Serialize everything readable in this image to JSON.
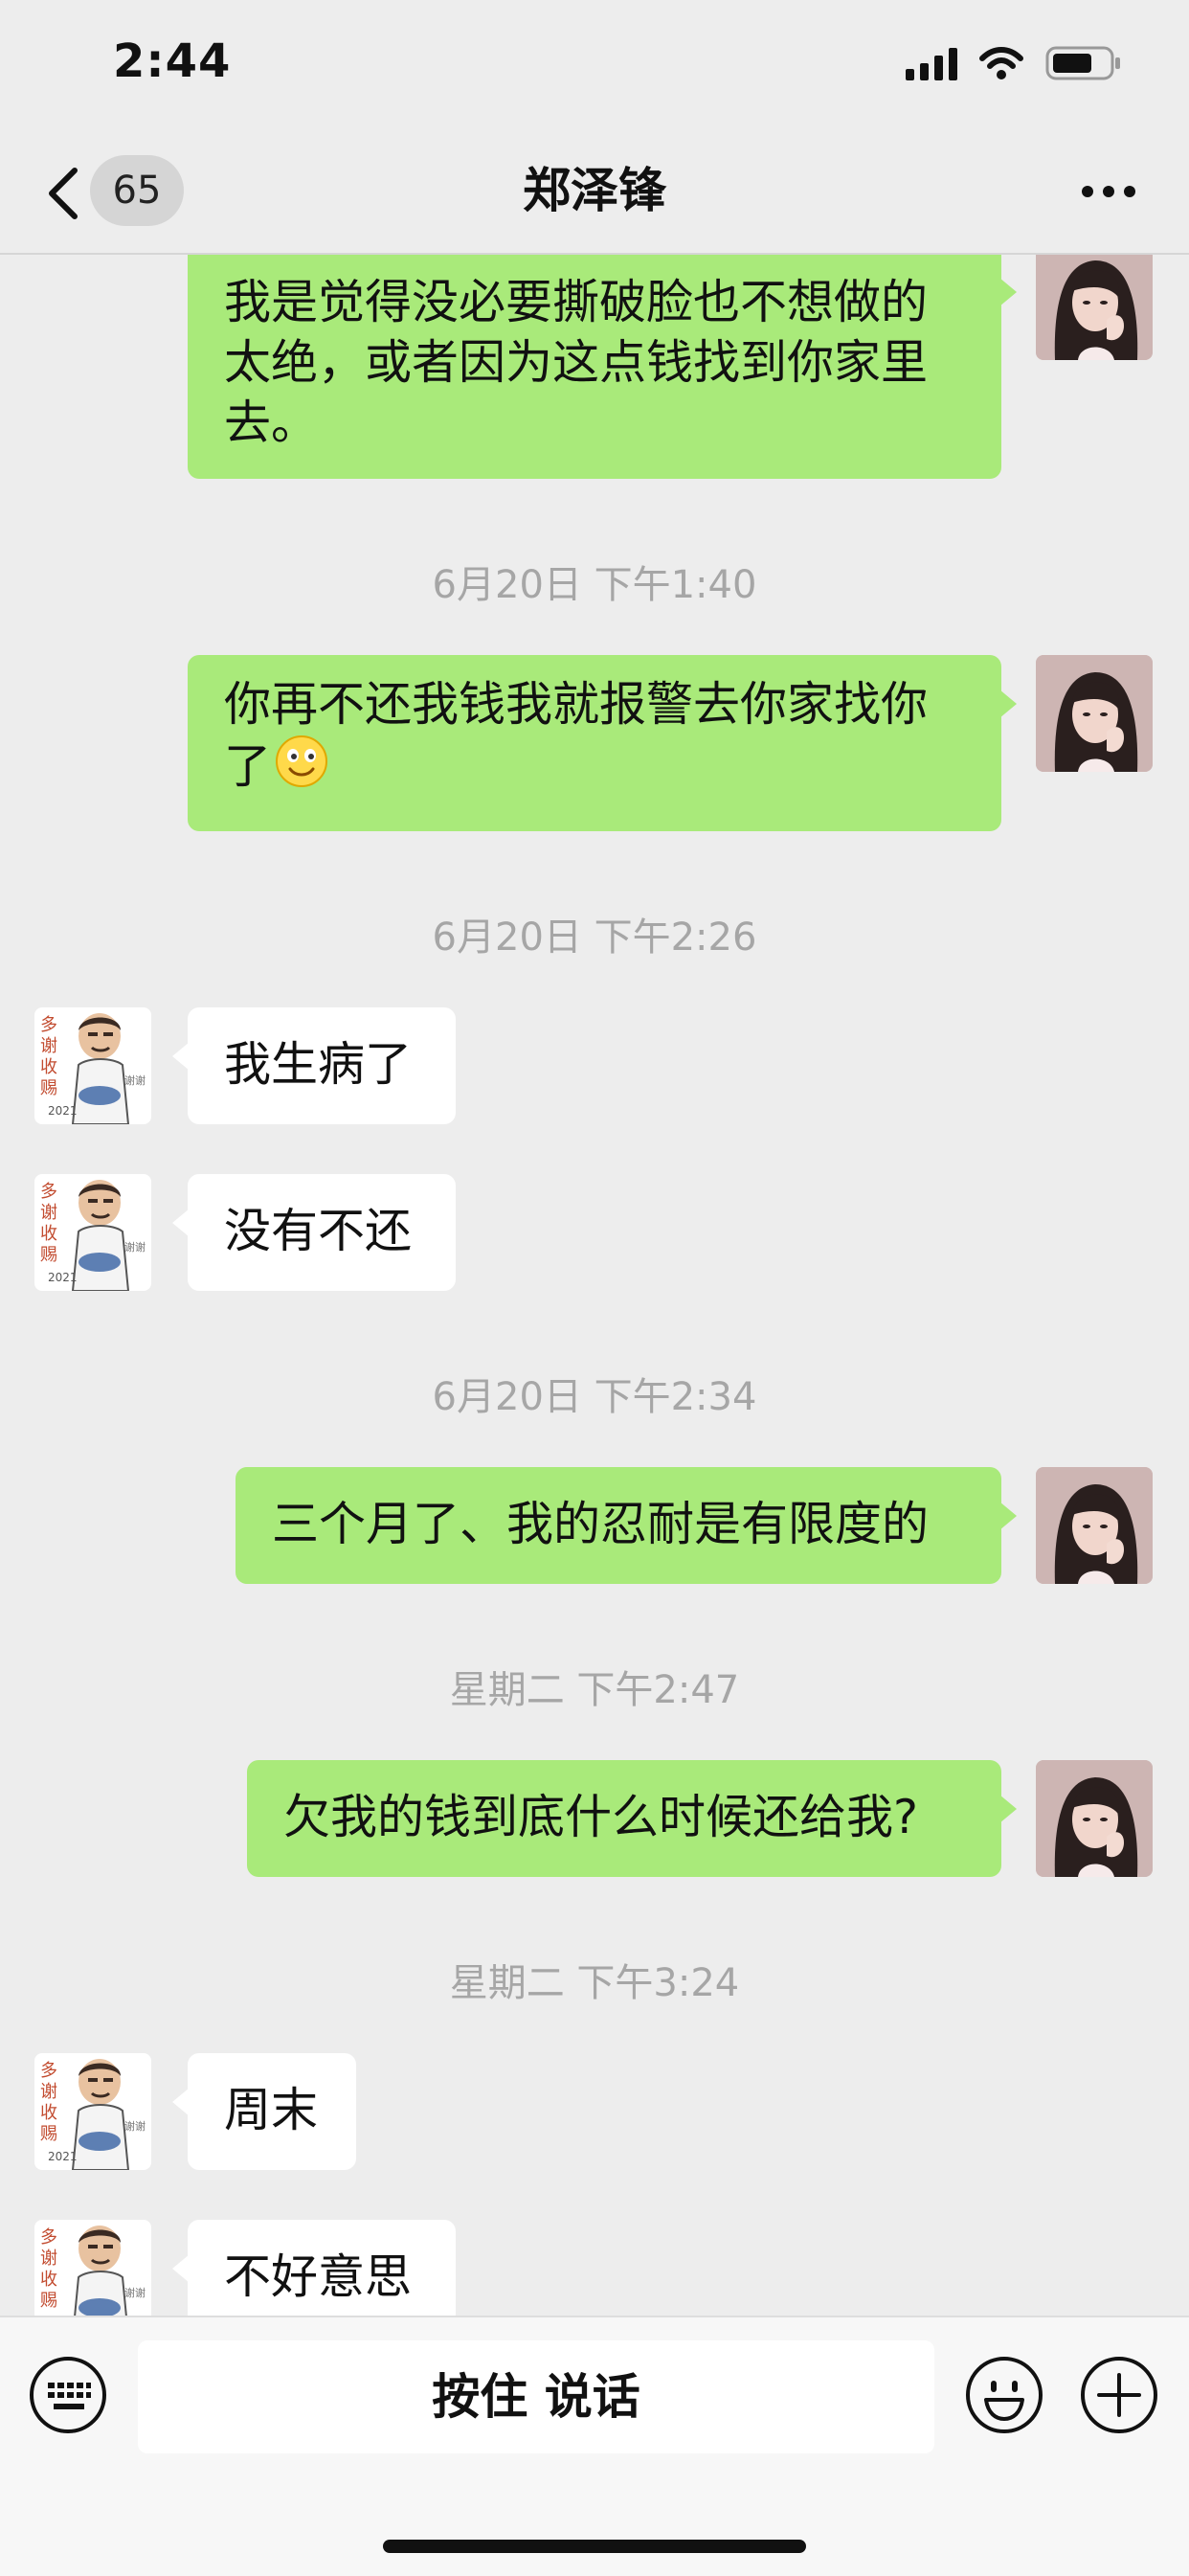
{
  "status_bar": {
    "time": "2:44"
  },
  "nav": {
    "unread_count": "65",
    "title": "郑泽锋"
  },
  "messages": [
    {
      "side": "me",
      "text": "我是觉得没必要撕破脸也不想做的太绝，或者因为这点钱找到你家里去。"
    },
    {
      "type": "time",
      "text": "6月20日 下午1:40"
    },
    {
      "side": "me",
      "text": "你再不还我钱我就报警去你家找你了",
      "emoji": "smile"
    },
    {
      "type": "time",
      "text": "6月20日 下午2:26"
    },
    {
      "side": "them",
      "text": "我生病了"
    },
    {
      "side": "them",
      "text": "没有不还"
    },
    {
      "type": "time",
      "text": "6月20日 下午2:34"
    },
    {
      "side": "me",
      "text": "三个月了、我的忍耐是有限度的"
    },
    {
      "type": "time",
      "text": "星期二 下午2:47"
    },
    {
      "side": "me",
      "text": "欠我的钱到底什么时候还给我?"
    },
    {
      "type": "time",
      "text": "星期二 下午3:24"
    },
    {
      "side": "them",
      "text": "周末"
    },
    {
      "side": "them",
      "text": "不好意思"
    }
  ],
  "input_bar": {
    "voice_label": "按住 说话"
  },
  "colors": {
    "background": "#ededed",
    "my_bubble": "#a9ea7a",
    "their_bubble": "#ffffff",
    "timestamp": "#a6a6a6"
  },
  "icons": [
    "signal-icon",
    "wifi-icon",
    "battery-icon",
    "back-chevron-icon",
    "more-dots-icon",
    "keyboard-icon",
    "emoji-icon",
    "plus-icon"
  ]
}
